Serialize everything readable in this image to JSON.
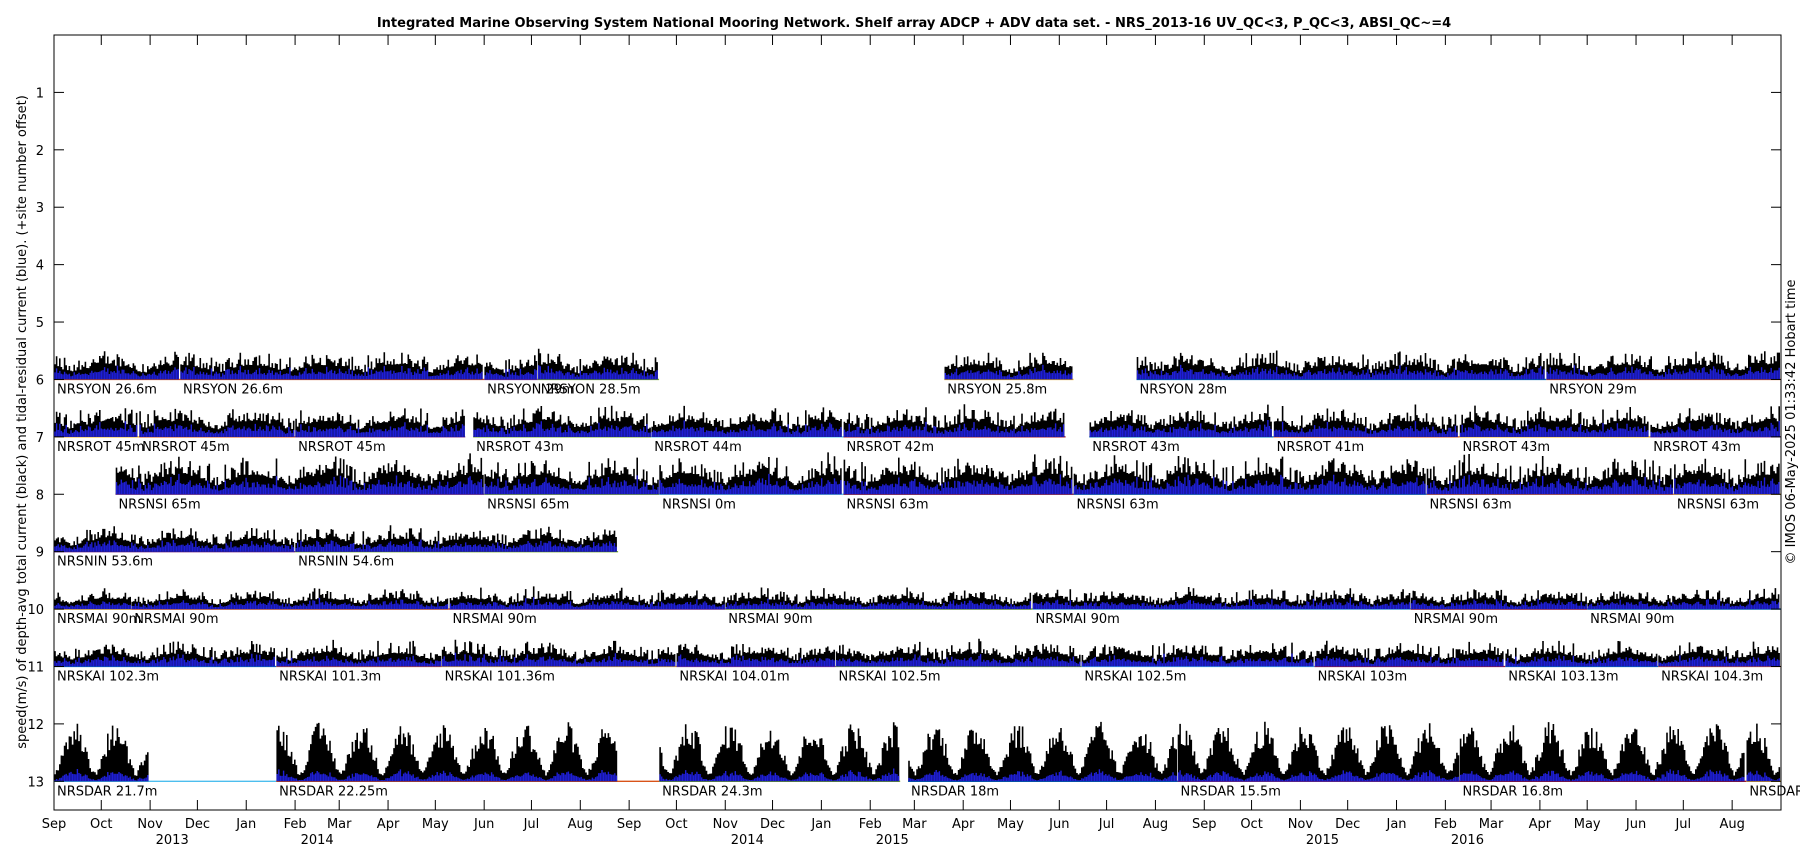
{
  "chart_data": {
    "type": "scatter",
    "title": "Integrated Marine Observing System National Mooring Network. Shelf array ADCP + ADV data set. - NRS_2013-16 UV_QC<3, P_QC<3, ABSI_QC~=4",
    "ylabel": "speed(m/s) of depth-avg total current (black) and tidal-residual current (blue). (+site number offset)",
    "side_note": "© IMOS 06-May-2025 01:33:42 Hobart time",
    "xlim": [
      "2013-09-01",
      "2016-09-01"
    ],
    "ylim": [
      0,
      13.5
    ],
    "y_reversed": true,
    "y_ticks": [
      1,
      2,
      3,
      4,
      5,
      6,
      7,
      8,
      9,
      10,
      11,
      12,
      13
    ],
    "x_month_ticks": [
      {
        "date": "2013-09-01",
        "label": "Sep"
      },
      {
        "date": "2013-10-01",
        "label": "Oct"
      },
      {
        "date": "2013-11-01",
        "label": "Nov"
      },
      {
        "date": "2013-12-01",
        "label": "Dec"
      },
      {
        "date": "2014-01-01",
        "label": "Jan"
      },
      {
        "date": "2014-02-01",
        "label": "Feb"
      },
      {
        "date": "2014-03-01",
        "label": "Mar"
      },
      {
        "date": "2014-04-01",
        "label": "Apr"
      },
      {
        "date": "2014-05-01",
        "label": "May"
      },
      {
        "date": "2014-06-01",
        "label": "Jun"
      },
      {
        "date": "2014-07-01",
        "label": "Jul"
      },
      {
        "date": "2014-08-01",
        "label": "Aug"
      },
      {
        "date": "2014-09-01",
        "label": "Sep"
      },
      {
        "date": "2014-10-01",
        "label": "Oct"
      },
      {
        "date": "2014-11-01",
        "label": "Nov"
      },
      {
        "date": "2014-12-01",
        "label": "Dec"
      },
      {
        "date": "2015-01-01",
        "label": "Jan"
      },
      {
        "date": "2015-02-01",
        "label": "Feb"
      },
      {
        "date": "2015-03-01",
        "label": "Mar"
      },
      {
        "date": "2015-04-01",
        "label": "Apr"
      },
      {
        "date": "2015-05-01",
        "label": "May"
      },
      {
        "date": "2015-06-01",
        "label": "Jun"
      },
      {
        "date": "2015-07-01",
        "label": "Jul"
      },
      {
        "date": "2015-08-01",
        "label": "Aug"
      },
      {
        "date": "2015-09-01",
        "label": "Sep"
      },
      {
        "date": "2015-10-01",
        "label": "Oct"
      },
      {
        "date": "2015-11-01",
        "label": "Nov"
      },
      {
        "date": "2015-12-01",
        "label": "Dec"
      },
      {
        "date": "2016-01-01",
        "label": "Jan"
      },
      {
        "date": "2016-02-01",
        "label": "Feb"
      },
      {
        "date": "2016-03-01",
        "label": "Mar"
      },
      {
        "date": "2016-04-01",
        "label": "Apr"
      },
      {
        "date": "2016-05-01",
        "label": "May"
      },
      {
        "date": "2016-06-01",
        "label": "Jun"
      },
      {
        "date": "2016-07-01",
        "label": "Jul"
      },
      {
        "date": "2016-08-01",
        "label": "Aug"
      }
    ],
    "x_year_ticks": [
      {
        "date": "2013-11-15",
        "label": "2013"
      },
      {
        "date": "2014-02-15",
        "label": "2014"
      },
      {
        "date": "2014-11-15",
        "label": "2014"
      },
      {
        "date": "2015-02-15",
        "label": "2015"
      },
      {
        "date": "2015-11-15",
        "label": "2015"
      },
      {
        "date": "2016-02-15",
        "label": "2016"
      }
    ],
    "sites": [
      {
        "baseline": 6,
        "amp": 0.55,
        "deployments": [
          {
            "label": "NRSYON 26.6m",
            "start": "2013-09-01",
            "end": "2013-11-20",
            "color": "#d95319"
          },
          {
            "label": "NRSYON 26.6m",
            "start": "2013-11-20",
            "end": "2014-06-01",
            "color": "#d95319"
          },
          {
            "label": "NRSYON 29m",
            "start": "2014-06-01",
            "end": "2014-07-05",
            "color": "#7e2f8e"
          },
          {
            "label": "NRSYON 28.5m",
            "start": "2014-07-05",
            "end": "2014-09-20",
            "color": "#77ac30"
          },
          {
            "label": "NRSYON 25.8m",
            "start": "2015-03-20",
            "end": "2015-06-10",
            "color": "#edb120"
          },
          {
            "label": "NRSYON 28m",
            "start": "2015-07-20",
            "end": "2016-04-05",
            "color": "#0072bd"
          },
          {
            "label": "NRSYON 29m",
            "start": "2016-04-05",
            "end": "2016-09-01",
            "color": "#d95319"
          }
        ]
      },
      {
        "baseline": 7,
        "amp": 0.6,
        "deployments": [
          {
            "label": "NRSROT 45m",
            "start": "2013-09-01",
            "end": "2013-10-25",
            "color": "#edb120"
          },
          {
            "label": "NRSROT 45m",
            "start": "2013-10-25",
            "end": "2014-02-01",
            "color": "#d95319"
          },
          {
            "label": "NRSROT 45m",
            "start": "2014-02-01",
            "end": "2014-05-20",
            "color": "#7e2f8e"
          },
          {
            "label": "NRSROT 43m",
            "start": "2014-05-25",
            "end": "2014-09-15",
            "color": "#77ac30"
          },
          {
            "label": "NRSROT 44m",
            "start": "2014-09-15",
            "end": "2015-01-15",
            "color": "#4dbeee"
          },
          {
            "label": "NRSROT 42m",
            "start": "2015-01-15",
            "end": "2015-06-05",
            "color": "#a2142f"
          },
          {
            "label": "NRSROT 43m",
            "start": "2015-06-20",
            "end": "2015-10-15",
            "color": "#0072bd"
          },
          {
            "label": "NRSROT 41m",
            "start": "2015-10-15",
            "end": "2016-02-10",
            "color": "#d95319"
          },
          {
            "label": "NRSROT 43m",
            "start": "2016-02-10",
            "end": "2016-06-10",
            "color": "#edb120"
          },
          {
            "label": "NRSROT 43m",
            "start": "2016-06-10",
            "end": "2016-09-01",
            "color": "#7e2f8e"
          }
        ]
      },
      {
        "baseline": 8,
        "amp": 0.75,
        "deployments": [
          {
            "label": "NRSNSI 65m",
            "start": "2013-10-10",
            "end": "2014-06-01",
            "color": "#7e2f8e"
          },
          {
            "label": "NRSNSI 65m",
            "start": "2014-06-01",
            "end": "2014-09-20",
            "color": "#77ac30"
          },
          {
            "label": "NRSNSI 0m",
            "start": "2014-09-20",
            "end": "2015-01-15",
            "color": "#4dbeee"
          },
          {
            "label": "NRSNSI 63m",
            "start": "2015-01-15",
            "end": "2015-06-10",
            "color": "#a2142f"
          },
          {
            "label": "NRSNSI 63m",
            "start": "2015-06-10",
            "end": "2016-01-20",
            "color": "#0072bd"
          },
          {
            "label": "NRSNSI 63m",
            "start": "2016-01-20",
            "end": "2016-06-25",
            "color": "#d95319"
          },
          {
            "label": "NRSNSI 63m",
            "start": "2016-06-25",
            "end": "2016-09-01",
            "color": "#edb120"
          }
        ]
      },
      {
        "baseline": 9,
        "amp": 0.5,
        "deployments": [
          {
            "label": "NRSNIN 53.6m",
            "start": "2013-09-01",
            "end": "2014-02-01",
            "color": "#7e2f8e"
          },
          {
            "label": "NRSNIN 54.6m",
            "start": "2014-02-01",
            "end": "2014-08-25",
            "color": "#77ac30"
          }
        ]
      },
      {
        "baseline": 10,
        "amp": 0.4,
        "deployments": [
          {
            "label": "NRSMAI 90m",
            "start": "2013-09-01",
            "end": "2013-10-20",
            "color": "#edb120"
          },
          {
            "label": "NRSMAI 90m",
            "start": "2013-10-20",
            "end": "2014-05-10",
            "color": "#d95319"
          },
          {
            "label": "NRSMAI 90m",
            "start": "2014-05-10",
            "end": "2014-11-01",
            "color": "#7e2f8e"
          },
          {
            "label": "NRSMAI 90m",
            "start": "2014-11-01",
            "end": "2015-05-15",
            "color": "#77ac30"
          },
          {
            "label": "NRSMAI 90m",
            "start": "2015-05-15",
            "end": "2016-01-10",
            "color": "#4dbeee"
          },
          {
            "label": "NRSMAI 90m",
            "start": "2016-01-10",
            "end": "2016-05-01",
            "color": "#a2142f"
          },
          {
            "label": "NRSMAI 90m",
            "start": "2016-05-01",
            "end": "2016-09-01",
            "color": "#0072bd"
          }
        ]
      },
      {
        "baseline": 11,
        "amp": 0.5,
        "deployments": [
          {
            "label": "NRSKAI 102.3m",
            "start": "2013-09-01",
            "end": "2014-01-20",
            "color": "#0072bd"
          },
          {
            "label": "NRSKAI 101.3m",
            "start": "2014-01-20",
            "end": "2014-05-05",
            "color": "#d95319"
          },
          {
            "label": "NRSKAI 101.36m",
            "start": "2014-05-05",
            "end": "2014-10-01",
            "color": "#edb120"
          },
          {
            "label": "NRSKAI 104.01m",
            "start": "2014-10-01",
            "end": "2015-01-10",
            "color": "#7e2f8e"
          },
          {
            "label": "NRSKAI 102.5m",
            "start": "2015-01-10",
            "end": "2015-06-15",
            "color": "#77ac30"
          },
          {
            "label": "NRSKAI 102.5m",
            "start": "2015-06-15",
            "end": "2015-11-10",
            "color": "#4dbeee"
          },
          {
            "label": "NRSKAI 103m",
            "start": "2015-11-10",
            "end": "2016-03-10",
            "color": "#a2142f"
          },
          {
            "label": "NRSKAI 103.13m",
            "start": "2016-03-10",
            "end": "2016-06-15",
            "color": "#0072bd"
          },
          {
            "label": "NRSKAI 104.3m",
            "start": "2016-06-15",
            "end": "2016-09-01",
            "color": "#d95319"
          }
        ]
      },
      {
        "baseline": 13,
        "amp": 1.05,
        "deployments": [
          {
            "label": "NRSDAR 21.7m",
            "start": "2013-09-01",
            "end": "2014-01-20",
            "color": "#4dbeee",
            "data_end": "2013-11-01"
          },
          {
            "label": "NRSDAR 22.25m",
            "start": "2014-01-20",
            "end": "2014-09-20",
            "color": "#d95319",
            "data_end": "2014-08-25"
          },
          {
            "label": "NRSDAR 24.3m",
            "start": "2014-09-20",
            "end": "2015-02-20",
            "color": "#77ac30",
            "data_end": "2015-02-20"
          },
          {
            "label": "NRSDAR 18m",
            "start": "2015-02-25",
            "end": "2015-08-15",
            "color": "#0072bd"
          },
          {
            "label": "NRSDAR 15.5m",
            "start": "2015-08-15",
            "end": "2016-02-10",
            "color": "#7e2f8e"
          },
          {
            "label": "NRSDAR 16.8m",
            "start": "2016-02-10",
            "end": "2016-08-10",
            "color": "#a2142f"
          },
          {
            "label": "NRSDAR",
            "start": "2016-08-10",
            "end": "2016-09-01",
            "color": "#edb120"
          }
        ]
      }
    ]
  }
}
